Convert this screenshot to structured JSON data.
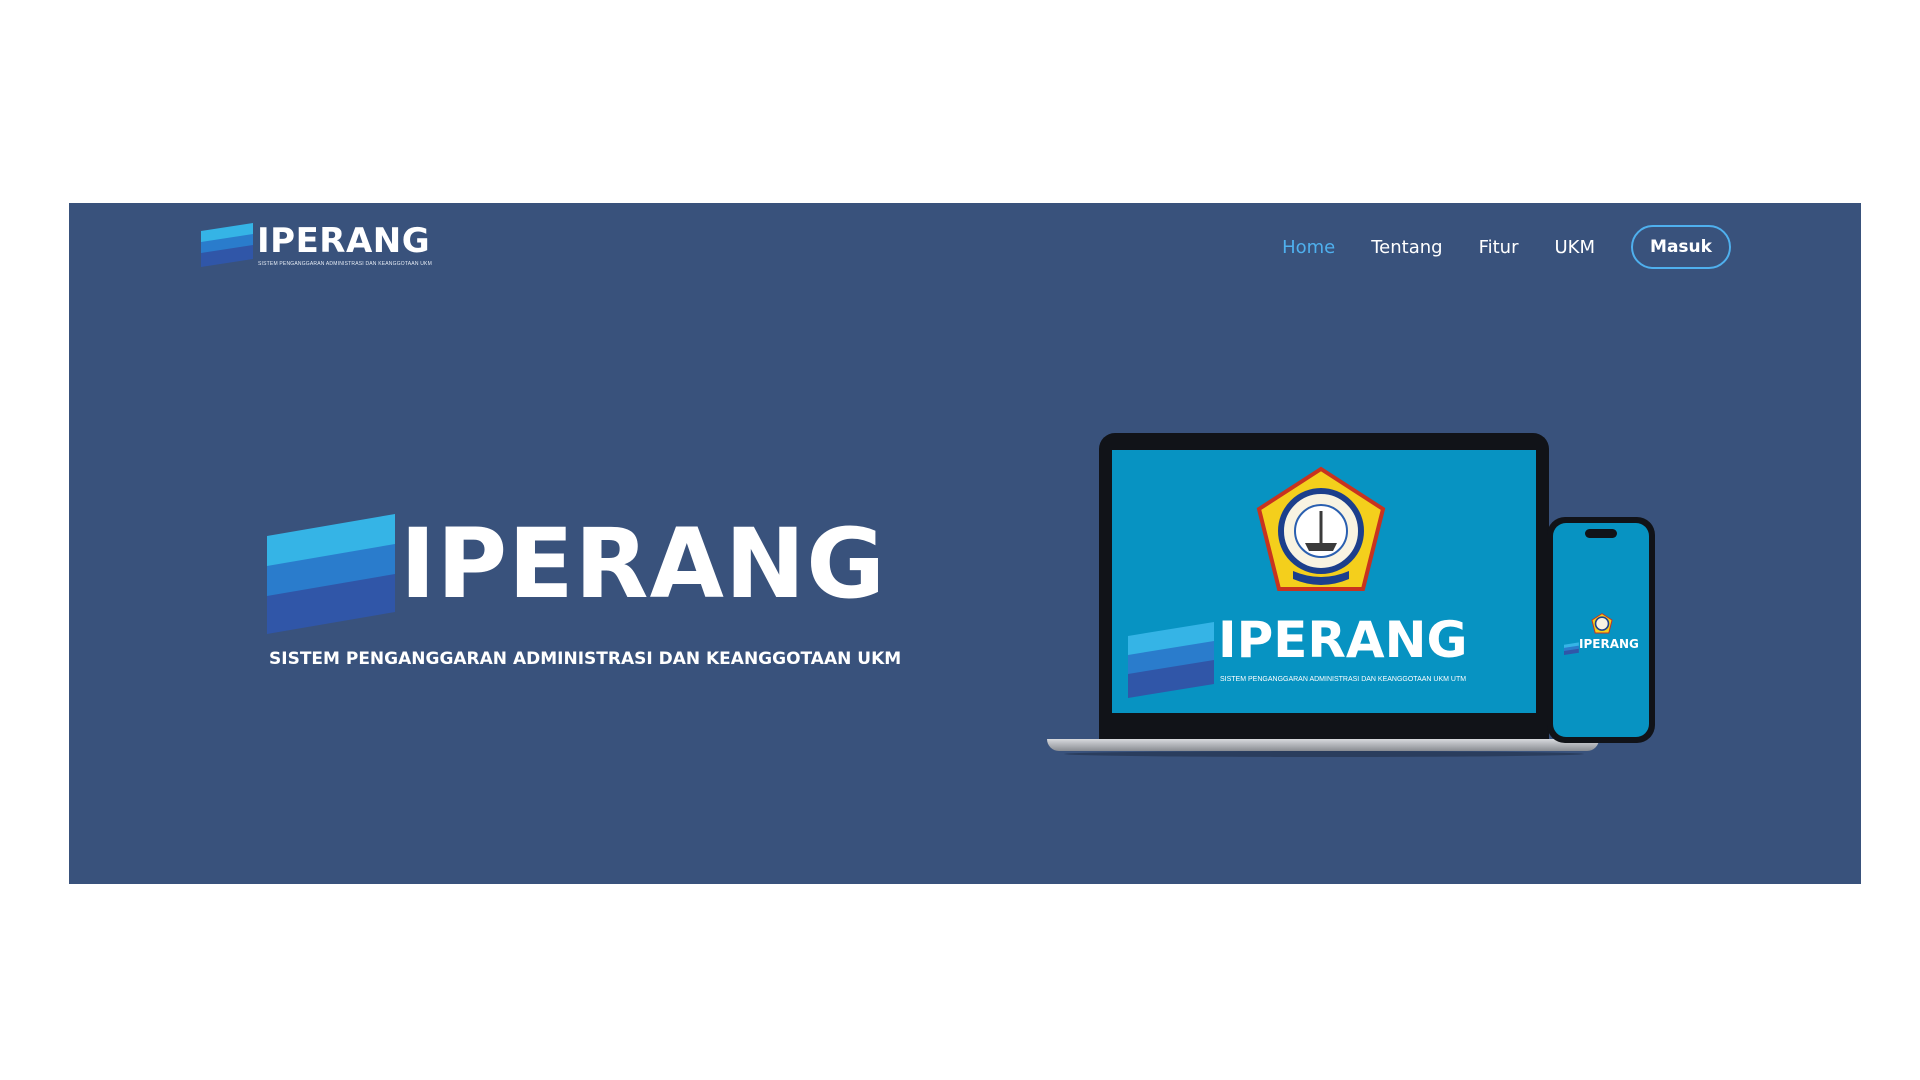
{
  "brand": {
    "name": "IPERANG",
    "tagline": "SISTEM PENGANGGARAN ADMINISTRASI DAN KEANGGOTAAN UKM",
    "screen_tagline": "SISTEM PENGANGGARAN ADMINISTRASI DAN KEANGGOTAAN UKM UTM"
  },
  "nav": {
    "items": [
      {
        "label": "Home",
        "active": true
      },
      {
        "label": "Tentang",
        "active": false
      },
      {
        "label": "Fitur",
        "active": false
      },
      {
        "label": "UKM",
        "active": false
      }
    ],
    "login_label": "Masuk"
  },
  "colors": {
    "hero_bg": "#39527c",
    "accent": "#4fb0ee",
    "screen_bg": "#0793c2",
    "seal_yellow": "#f4cf1c"
  },
  "icons": {
    "logo_mark": "stacked-stripes-logo-icon",
    "seal": "university-seal-icon"
  }
}
